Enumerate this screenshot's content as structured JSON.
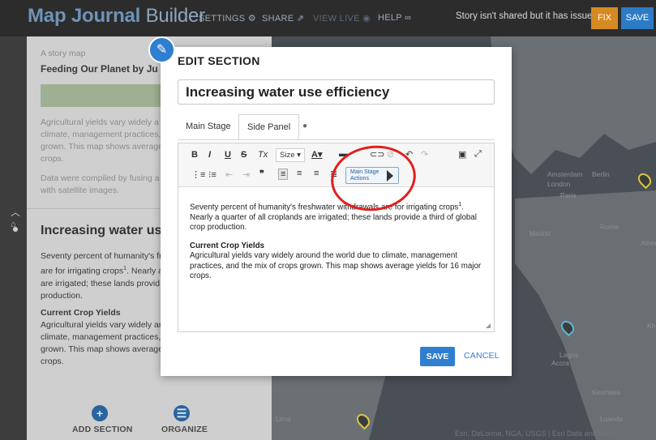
{
  "topbar": {
    "title_bold": "Map Journal",
    "title_light": "Builder",
    "nav": [
      "SETTINGS",
      "SHARE",
      "VIEW LIVE",
      "HELP"
    ],
    "status": "Story isn't shared but it has issues",
    "fix_label": "FIX",
    "save_label": "SAVE"
  },
  "sidepanel": {
    "subtitle": "A story map",
    "story_title": "Feeding Our Planet by Ju",
    "intro_1": [
      "Agricultural yields vary widely a",
      "climate, management practices,",
      "grown. This map shows average",
      "crops."
    ],
    "intro_2": [
      "Data were compiled by fusing a",
      "with satellite images."
    ],
    "section_title": "Increasing water us",
    "body_1": [
      "Seventy percent of humanity's fr",
      "are for irrigating crops",
      "are irrigated; these lands provid",
      "production."
    ],
    "body_1_sup": "1",
    "body_1_tail": ". Nearly a",
    "crop_heading": "Current Crop Yields",
    "body_2": [
      "Agricultural yields vary widely ar",
      "climate, management practices,",
      "grown. This map shows average",
      "crops."
    ],
    "add_section": "ADD SECTION",
    "organize": "ORGANIZE"
  },
  "map": {
    "labels": [
      "Amsterdam",
      "Berlin",
      "London",
      "Paris",
      "Madrid",
      "Rome",
      "Athens",
      "Lagos",
      "Accra",
      "Kinshasa",
      "Luanda",
      "Lima",
      "Kh"
    ],
    "attribution": "Esri, DeLorme, NGA, USGS | Esri Data and Maps..."
  },
  "modal": {
    "heading": "EDIT SECTION",
    "section_title_value": "Increasing water use efficiency",
    "tabs": [
      "Main Stage",
      "Side Panel"
    ],
    "help": "?",
    "toolbar": {
      "size": "Size",
      "main_stage_actions": "Main Stage Actions"
    },
    "body_p1": "Seventy percent of humanity's freshwater withdrawals are for irrigating crops",
    "body_p1_sup": "1",
    "body_p1_rest": ". Nearly a quarter of all croplands are irrigated; these lands provide a third of global crop production.",
    "body_heading": "Current Crop Yields",
    "body_p2": "Agricultural yields vary widely around the world due to climate, management practices, and the mix of crops grown. This map shows average yields for 16 major crops.",
    "save": "SAVE",
    "cancel": "CANCEL"
  }
}
